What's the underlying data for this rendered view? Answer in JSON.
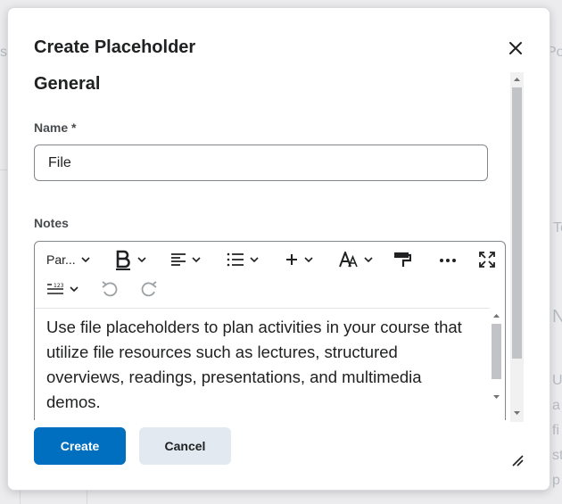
{
  "background": {
    "fragments": [
      "ss",
      "Po",
      "To",
      "N",
      "U",
      "a",
      "fi",
      "st",
      "p"
    ]
  },
  "dialog": {
    "title": "Create Placeholder",
    "close_icon": "close-icon",
    "section_heading": "General",
    "name": {
      "label": "Name *",
      "value": "File"
    },
    "notes": {
      "label": "Notes",
      "toolbar": {
        "paragraph_label": "Par...",
        "icons": [
          "bold-icon",
          "align-icon",
          "list-icon",
          "insert-plus-icon",
          "font-size-icon",
          "format-painter-icon",
          "more-icon",
          "fullscreen-icon",
          "line-spacing-icon",
          "undo-icon",
          "redo-icon"
        ]
      },
      "content": "Use file placeholders to plan activities in your course that utilize file resources such as lectures, structured overviews, readings, presentations, and multimedia demos."
    },
    "buttons": {
      "create": "Create",
      "cancel": "Cancel"
    }
  },
  "colors": {
    "primary": "#006fbf",
    "secondary": "#e3e9f1",
    "text": "#202122",
    "border": "#80868b"
  }
}
